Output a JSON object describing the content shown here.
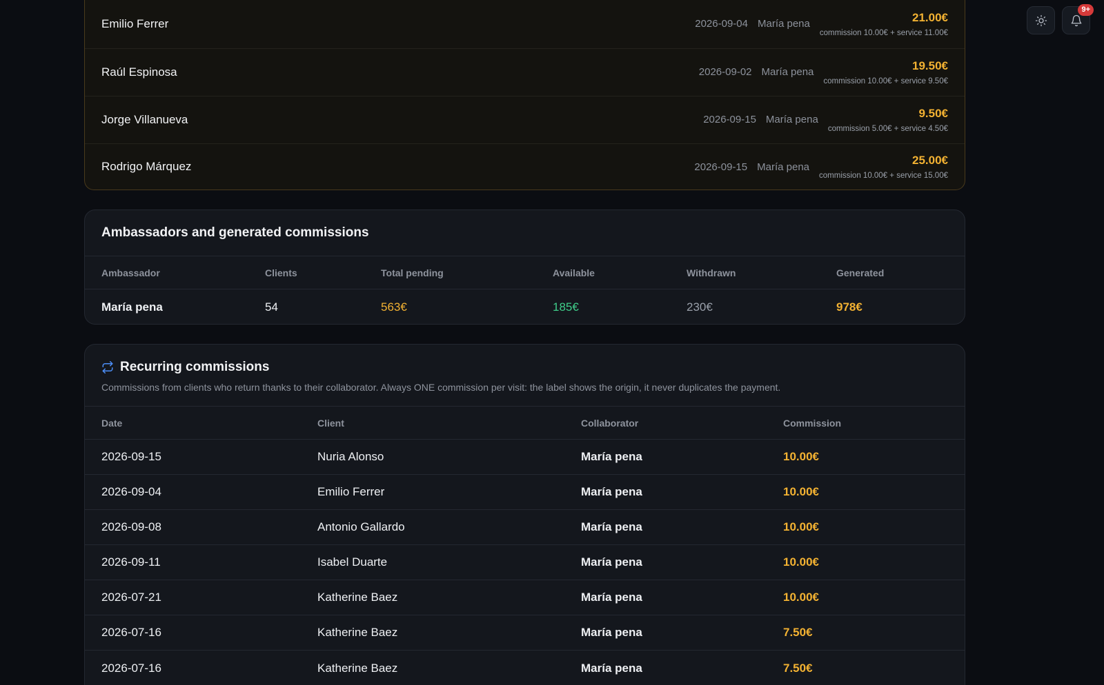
{
  "header": {
    "theme_icon": "sun-icon",
    "bell_icon": "bell-icon",
    "notification_badge": "9+"
  },
  "pending_list": [
    {
      "client": "Emilio Ferrer",
      "date": "2026-09-04",
      "ambassador": "María pena",
      "amount": "21.00€",
      "breakdown": "commission 10.00€ + service 11.00€"
    },
    {
      "client": "Raúl Espinosa",
      "date": "2026-09-02",
      "ambassador": "María pena",
      "amount": "19.50€",
      "breakdown": "commission 10.00€ + service 9.50€"
    },
    {
      "client": "Jorge Villanueva",
      "date": "2026-09-15",
      "ambassador": "María pena",
      "amount": "9.50€",
      "breakdown": "commission 5.00€ + service 4.50€"
    },
    {
      "client": "Rodrigo Márquez",
      "date": "2026-09-15",
      "ambassador": "María pena",
      "amount": "25.00€",
      "breakdown": "commission 10.00€ + service 15.00€"
    }
  ],
  "ambassadors": {
    "title": "Ambassadors and generated commissions",
    "columns": [
      "Ambassador",
      "Clients",
      "Total pending",
      "Available",
      "Withdrawn",
      "Generated"
    ],
    "rows": [
      {
        "ambassador": "María pena",
        "clients": "54",
        "total_pending": "563€",
        "available": "185€",
        "withdrawn": "230€",
        "generated": "978€"
      }
    ]
  },
  "recurring": {
    "icon": "repeat-icon",
    "title": "Recurring commissions",
    "description": "Commissions from clients who return thanks to their collaborator. Always ONE commission per visit: the label shows the origin, it never duplicates the payment.",
    "columns": [
      "Date",
      "Client",
      "Collaborator",
      "Commission"
    ],
    "rows": [
      {
        "date": "2026-09-15",
        "client": "Nuria Alonso",
        "collaborator": "María pena",
        "commission": "10.00€"
      },
      {
        "date": "2026-09-04",
        "client": "Emilio Ferrer",
        "collaborator": "María pena",
        "commission": "10.00€"
      },
      {
        "date": "2026-09-08",
        "client": "Antonio Gallardo",
        "collaborator": "María pena",
        "commission": "10.00€"
      },
      {
        "date": "2026-09-11",
        "client": "Isabel Duarte",
        "collaborator": "María pena",
        "commission": "10.00€"
      },
      {
        "date": "2026-07-21",
        "client": "Katherine Baez",
        "collaborator": "María pena",
        "commission": "10.00€"
      },
      {
        "date": "2026-07-16",
        "client": "Katherine Baez",
        "collaborator": "María pena",
        "commission": "7.50€"
      },
      {
        "date": "2026-07-16",
        "client": "Katherine Baez",
        "collaborator": "María pena",
        "commission": "7.50€"
      }
    ]
  },
  "colors": {
    "accent_orange": "#f3b232",
    "available_green": "#3fce8a",
    "recurring_icon_blue": "#4c8ef7",
    "badge_red": "#d63a3a"
  }
}
